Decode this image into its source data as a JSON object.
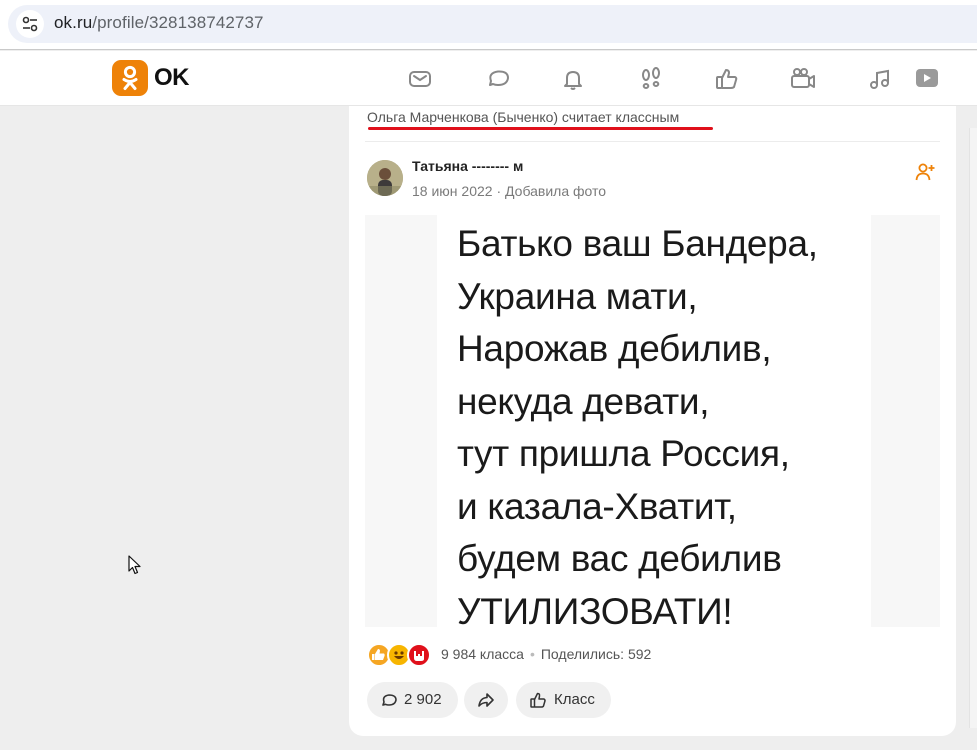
{
  "browser": {
    "url_host": "ok.ru",
    "url_path": "/profile/328138742737",
    "site_info_icon": "tune-icon"
  },
  "header": {
    "logo_text": "OK",
    "brand_color": "#ee8208",
    "nav_icons": [
      "mail-icon",
      "chat-bubble-icon",
      "bell-icon",
      "footprints-icon",
      "thumbs-up-icon",
      "video-camera-icon",
      "music-note-icon",
      "video-play-icon"
    ]
  },
  "feed": {
    "liker_text": "Ольга Марченкова (Быченко) считает классным",
    "post": {
      "author": "Татьяна -------- м",
      "date": "18 июн 2022",
      "action": "Добавила фото",
      "image_lines": [
        "Батько ваш Бандера,",
        "Украина мати,",
        "Нарожав дебилив,",
        "некуда девати,",
        "тут пришла Россия,",
        "и казала-Хватит,",
        "будем вас дебилив",
        "УТИЛИЗОВАТИ!"
      ],
      "likes_text": "9 984 класса",
      "shares_text": "Поделились: 592",
      "comments_count": "2 902",
      "class_label": "Класс"
    }
  },
  "accent_red": "#e0101b"
}
